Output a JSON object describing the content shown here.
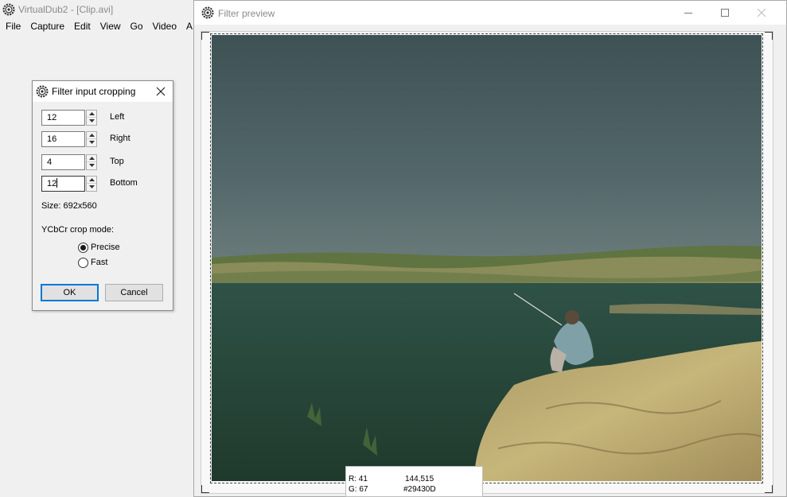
{
  "main_window": {
    "title": "VirtualDub2  - [Clip.avi]",
    "menu": [
      "File",
      "Capture",
      "Edit",
      "View",
      "Go",
      "Video",
      "A"
    ]
  },
  "crop_dialog": {
    "title": "Filter input cropping",
    "fields": [
      {
        "value": "12",
        "label": "Left"
      },
      {
        "value": "16",
        "label": "Right"
      },
      {
        "value": "4",
        "label": "Top"
      },
      {
        "value": "12",
        "label": "Bottom"
      }
    ],
    "size_text": "Size: 692x560",
    "mode_label": "YCbCr crop mode:",
    "modes": [
      {
        "label": "Precise",
        "checked": true
      },
      {
        "label": "Fast",
        "checked": false
      }
    ],
    "ok_label": "OK",
    "cancel_label": "Cancel"
  },
  "preview_window": {
    "title": "Filter preview",
    "readout": {
      "r": "R: 41",
      "g": "G: 67",
      "coords": "144,515",
      "hex": "#29430D"
    }
  },
  "colors": {
    "sky": "#4a5d5e",
    "water": "#2c4c40",
    "rock": "#b5a56c",
    "vegetation": "#4a6a2a",
    "accent": "#0078d7"
  }
}
